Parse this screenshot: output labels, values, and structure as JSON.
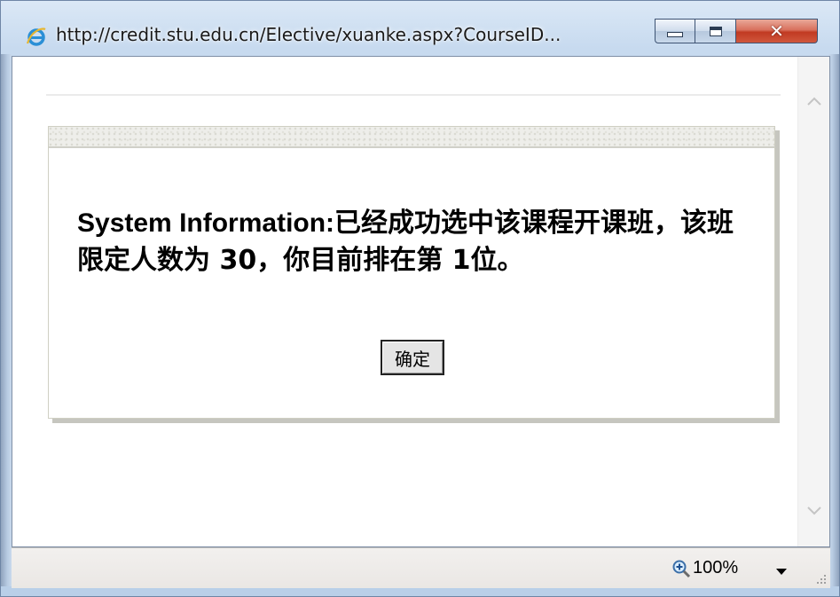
{
  "window": {
    "title": "http://credit.stu.edu.cn/Elective/xuanke.aspx?CourseID..."
  },
  "dialog": {
    "label": "System Information:",
    "message": "已经成功选中该课程开课班，该班限定人数为 30，你目前排在第 1位。",
    "ok_label": "确定"
  },
  "statusbar": {
    "zoom": "100%"
  },
  "icons": {
    "browser": "ie-logo-icon",
    "minimize": "minimize-icon",
    "maximize": "maximize-icon",
    "close": "close-icon",
    "scroll_up": "chevron-up-icon",
    "scroll_down": "chevron-down-icon",
    "zoom": "zoom-in-icon",
    "zoom_menu": "dropdown-arrow-icon",
    "resize": "resize-grip-icon"
  },
  "colors": {
    "close_button": "#c13a22",
    "frame": "#c7daef"
  }
}
